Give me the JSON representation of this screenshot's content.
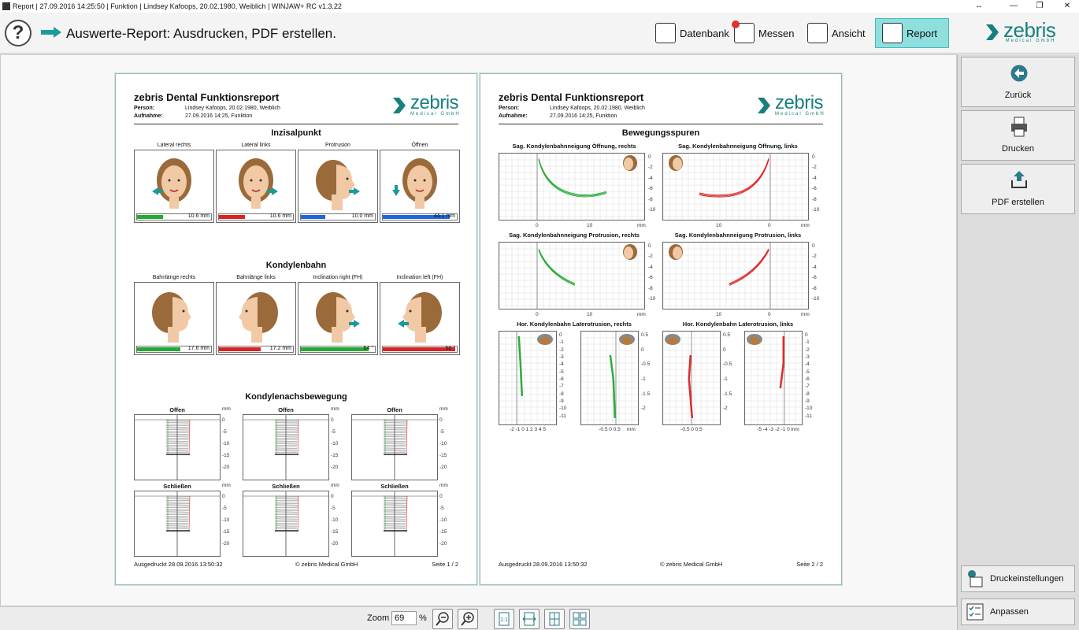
{
  "window": {
    "title": "Report | 27.09.2016 14:25:50 | Funktion | Lindsey Kafoops, 20.02.1980, Weiblich | WINJAW+ RC v1.3.22",
    "controls": [
      "↔",
      "—",
      "❐",
      "✕"
    ]
  },
  "header": {
    "help_glyph": "?",
    "title": "Auswerte-Report: Ausdrucken, PDF erstellen.",
    "nav": [
      {
        "label": "Datenbank",
        "icon": "database-icon"
      },
      {
        "label": "Messen",
        "icon": "measure-icon"
      },
      {
        "label": "Ansicht",
        "icon": "view-icon"
      },
      {
        "label": "Report",
        "icon": "report-icon",
        "active": true
      }
    ],
    "logo": {
      "text": "zebris",
      "sub": "Medical GmbH",
      "color": "#17807f"
    }
  },
  "sidebar": {
    "buttons": [
      {
        "label": "Zurück",
        "icon": "back-arrow-icon"
      },
      {
        "label": "Drucken",
        "icon": "printer-icon"
      },
      {
        "label": "PDF erstellen",
        "icon": "upload-icon"
      }
    ],
    "small_buttons": [
      {
        "label": "Druckeinstellungen",
        "icon": "print-settings-icon"
      },
      {
        "label": "Anpassen",
        "icon": "checklist-icon"
      }
    ]
  },
  "bottom": {
    "zoom_label": "Zoom",
    "zoom_value": "69",
    "zoom_unit": "%"
  },
  "report": {
    "title": "zebris Dental Funktionsreport",
    "person_label": "Person:",
    "person_value": "Lindsey Kafoops, 20.02.1980, Weiblich",
    "recording_label": "Aufnahme:",
    "recording_value": "27.09.2016 14:25, Funktion",
    "printed": "Ausgedruckt 28.09.2016 13:50:32",
    "copyright": "© zebris Medical GmbH",
    "page1_no": "Seite 1 / 2",
    "page2_no": "Seite 2 / 2"
  },
  "page1": {
    "inzisal": {
      "title": "Inzisalpunkt",
      "panels": [
        {
          "caption": "Lateral rechts",
          "value": "10.6 mm",
          "fill": 0.35,
          "color": "#22aa33"
        },
        {
          "caption": "Lateral links",
          "value": "10.6 mm",
          "fill": 0.35,
          "color": "#dd2222"
        },
        {
          "caption": "Protrusion",
          "value": "10.0 mm",
          "fill": 0.33,
          "color": "#2266dd"
        },
        {
          "caption": "Öffnen",
          "value": "44.1 mm",
          "fill": 0.9,
          "color": "#2266dd"
        }
      ]
    },
    "kondylenbahn": {
      "title": "Kondylenbahn",
      "panels": [
        {
          "caption": "Bahnlänge rechts",
          "value": "17.6 mm",
          "fill": 0.58,
          "color": "#22aa33"
        },
        {
          "caption": "Bahnlänge links",
          "value": "17.2 mm",
          "fill": 0.56,
          "color": "#dd2222"
        },
        {
          "caption": "Inclination right (FH)",
          "value": "64 °",
          "fill": 0.92,
          "color": "#22aa33"
        },
        {
          "caption": "Inclination left (FH)",
          "value": "58 °",
          "fill": 0.98,
          "color": "#dd2222"
        }
      ]
    },
    "achs": {
      "title": "Kondylenachsbewegung",
      "rows": [
        {
          "label": "Offen"
        },
        {
          "label": "Schließen"
        }
      ],
      "unit": "mm",
      "yticks": [
        "0",
        "-5",
        "-10",
        "-15",
        "-20"
      ]
    }
  },
  "page2": {
    "title": "Bewegungsspuren",
    "sag": [
      {
        "title": "Sag. Kondylenbahnneigung Öffnung, rechts",
        "color": "#22aa33",
        "xticks": [
          "0",
          "10"
        ]
      },
      {
        "title": "Sag. Kondylenbahnneigung Öffnung, links",
        "color": "#dd2222",
        "xticks": [
          "10",
          "0"
        ]
      },
      {
        "title": "Sag. Kondylenbahnneigung Protrusion, rechts",
        "color": "#22aa33",
        "xticks": [
          "0",
          "10"
        ]
      },
      {
        "title": "Sag. Kondylenbahnneigung Protrusion, links",
        "color": "#dd2222",
        "xticks": [
          "10",
          "0"
        ]
      }
    ],
    "sag_yticks": [
      "0",
      "-2",
      "-4",
      "-6",
      "-8",
      "-10"
    ],
    "unit": "mm",
    "hor": [
      {
        "title": "Hor. Kondylenbahn Laterotrusion, rechts"
      },
      {
        "title": "Hor. Kondylenbahn Laterotrusion, links"
      }
    ],
    "hor_yticks": [
      "0",
      "-1",
      "-2",
      "-3",
      "-4",
      "-5",
      "-6",
      "-7",
      "-8",
      "-9",
      "-10",
      "-11"
    ],
    "hor_yticks_small": [
      "0.5",
      "0",
      "-0.5",
      "-1",
      "-1.5",
      "-2"
    ],
    "hor_xticks_a": "-2 -1 0 1 2 3 4 5",
    "hor_xticks_b": "-0.5 0 0.5",
    "hor_xticks_c": "-0.5 0 0.5",
    "hor_xticks_d": "-5 -4 -3 -2 -1 0"
  }
}
